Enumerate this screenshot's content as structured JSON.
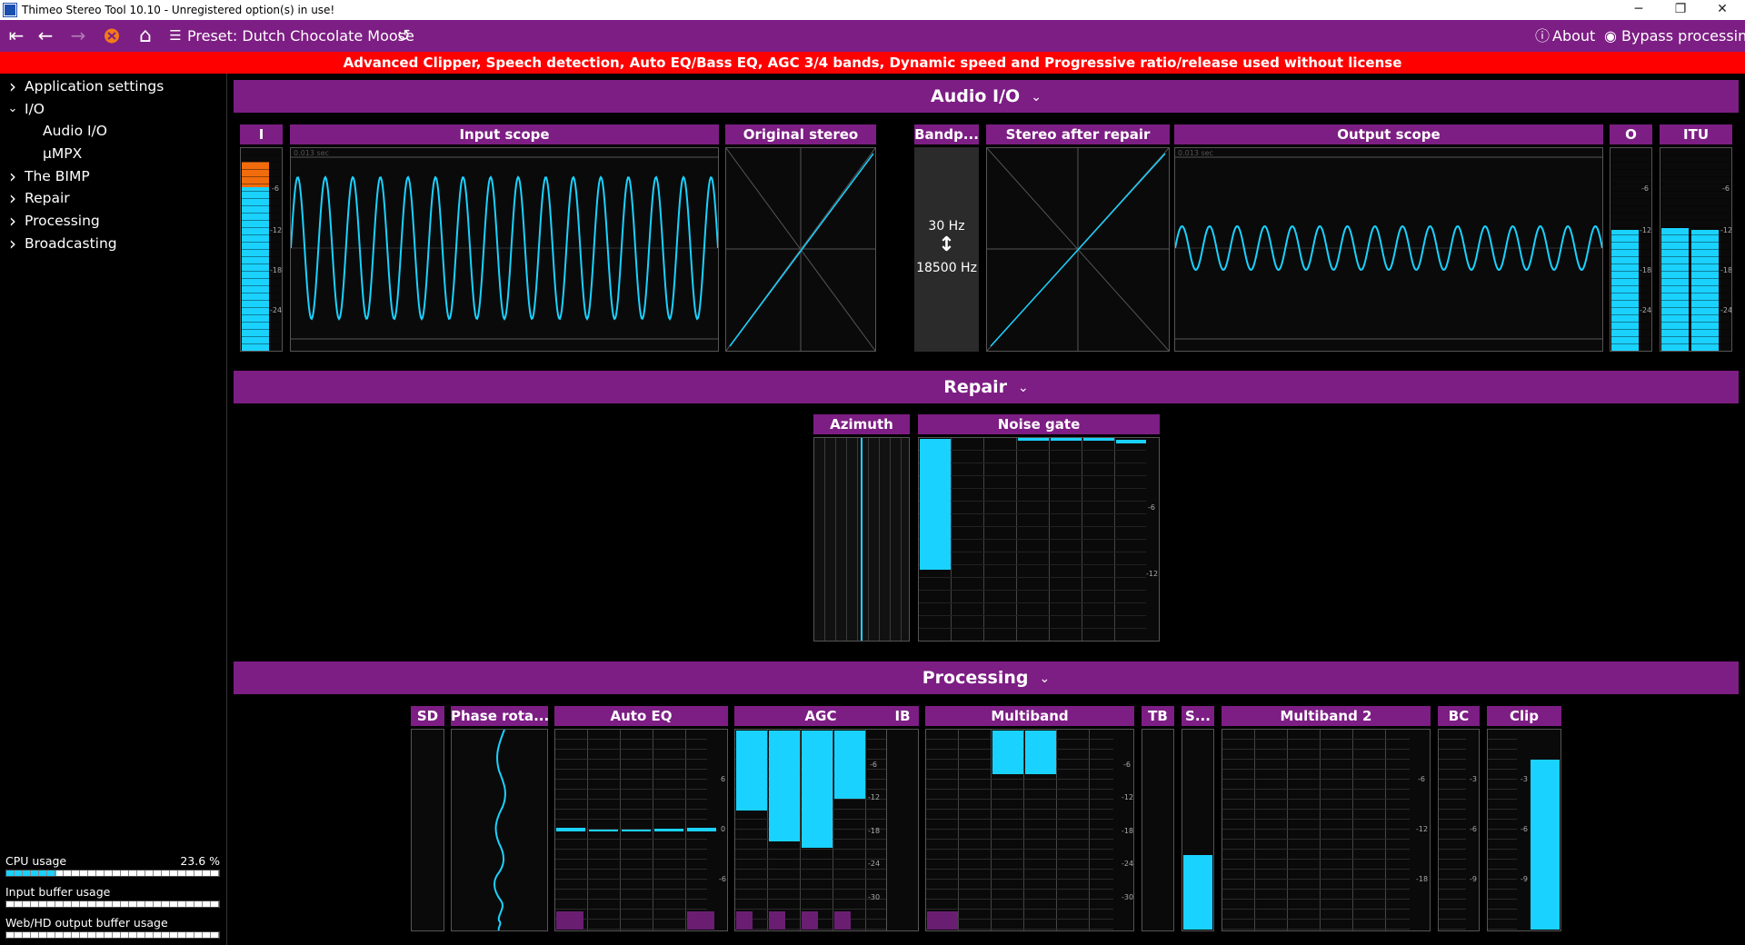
{
  "window": {
    "title": "Thimeo Stereo Tool 10.10 - Unregistered option(s) in use!",
    "minimize": "─",
    "restore": "❐",
    "close": "✕"
  },
  "toolbar": {
    "preset_label": "Preset: Dutch Chocolate Moose",
    "about_label": "About",
    "bypass_label": "Bypass processing"
  },
  "warning": "Advanced Clipper, Speech detection, Auto EQ/Bass EQ, AGC 3/4 bands, Dynamic speed and Progressive ratio/release used without license",
  "sidebar": {
    "items": [
      {
        "label": "Application settings",
        "chevron": "›",
        "level": 0
      },
      {
        "label": "I/O",
        "chevron": "⌄",
        "level": 0
      },
      {
        "label": "Audio I/O",
        "chevron": "",
        "level": 1
      },
      {
        "label": "µMPX",
        "chevron": "",
        "level": 1
      },
      {
        "label": "The BIMP",
        "chevron": "›",
        "level": 0
      },
      {
        "label": "Repair",
        "chevron": "›",
        "level": 0
      },
      {
        "label": "Processing",
        "chevron": "›",
        "level": 0
      },
      {
        "label": "Broadcasting",
        "chevron": "›",
        "level": 0
      }
    ],
    "cpu": {
      "label": "CPU usage",
      "value": "23.6 %",
      "fraction": 0.236
    },
    "input_buffer": {
      "label": "Input buffer usage",
      "fraction": 0.0
    },
    "output_buffer": {
      "label": "Web/HD output buffer usage",
      "fraction": 0.0
    }
  },
  "sections": {
    "audio_io": "Audio I/O",
    "repair": "Repair",
    "processing": "Processing",
    "chevron": "⌄"
  },
  "audio_io": {
    "input_meter": {
      "title": "I",
      "ticks": [
        "-6",
        "-12",
        "-18",
        "-24"
      ]
    },
    "input_scope": {
      "title": "Input scope",
      "time": "0.013 sec"
    },
    "original_stereo": {
      "title": "Original stereo"
    },
    "bandpass": {
      "title": "Bandp...",
      "low": "30 Hz",
      "high": "18500 Hz",
      "arrow": "↕"
    },
    "stereo_after_repair": {
      "title": "Stereo after repair"
    },
    "output_scope": {
      "title": "Output scope",
      "time": "0.013 sec"
    },
    "output_meter": {
      "title": "O",
      "ticks": [
        "-6",
        "-12",
        "-18",
        "-24"
      ]
    },
    "itu_meter": {
      "title": "ITU",
      "ticks": [
        "-6",
        "-12",
        "-18",
        "-24"
      ]
    }
  },
  "repair": {
    "azimuth": {
      "title": "Azimuth"
    },
    "noise_gate": {
      "title": "Noise gate",
      "ticks": [
        "-6",
        "-12"
      ]
    }
  },
  "processing": {
    "sd": {
      "title": "SD"
    },
    "phase": {
      "title": "Phase rota..."
    },
    "auto_eq": {
      "title": "Auto EQ",
      "ticks": [
        "6",
        "0",
        "-6"
      ]
    },
    "agc": {
      "title": "AGC",
      "ticks": [
        "-6",
        "-12",
        "-18",
        "-24",
        "-30"
      ]
    },
    "ib": {
      "title": "IB"
    },
    "multiband": {
      "title": "Multiband",
      "ticks": [
        "-6",
        "-12",
        "-18",
        "-24",
        "-30"
      ]
    },
    "tb": {
      "title": "TB"
    },
    "s": {
      "title": "S..."
    },
    "multiband2": {
      "title": "Multiband 2",
      "ticks": [
        "-6",
        "-12",
        "-18"
      ]
    },
    "bc": {
      "title": "BC",
      "ticks": [
        "-3",
        "-6",
        "-9"
      ]
    },
    "clip": {
      "title": "Clip",
      "ticks": [
        "-3",
        "-6",
        "-9"
      ]
    }
  },
  "colors": {
    "accent": "#7d1e84",
    "meter": "#1ad2ff",
    "warning": "#ff0000",
    "peak": "#f26c0d"
  },
  "icons": {
    "first": "⇤",
    "back": "←",
    "forward": "→",
    "home": "⌂",
    "list": "☰",
    "reload": "↺",
    "info": "ⓘ",
    "bypass": "◉"
  }
}
